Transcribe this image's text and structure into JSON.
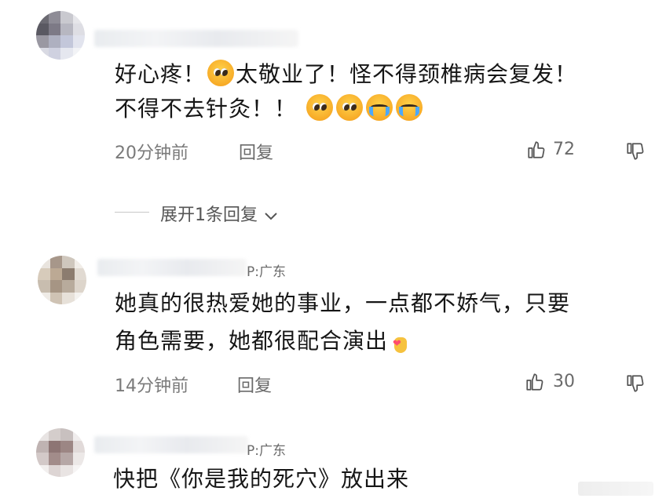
{
  "comments": [
    {
      "location": "",
      "text_line1": "好心疼！",
      "text_line1b": "太敬业了！怪不得颈椎病会复发！",
      "text_line2": "不得不去针灸！！",
      "time": "20分钟前",
      "reply_label": "回复",
      "likes": "72",
      "expand_label": "展开1条回复"
    },
    {
      "location": "P:广东",
      "text_line1": "她真的很热爱她的事业，一点都不娇气，只要",
      "text_line2": "角色需要，她都很配合演出",
      "time": "14分钟前",
      "reply_label": "回复",
      "likes": "30"
    },
    {
      "location": "P:广东",
      "text_line1": "快把《你是我的死穴》放出来"
    }
  ],
  "icons": {
    "like": "thumbs-up-icon",
    "dislike": "thumbs-down-icon",
    "expand": "chevron-down-icon"
  }
}
